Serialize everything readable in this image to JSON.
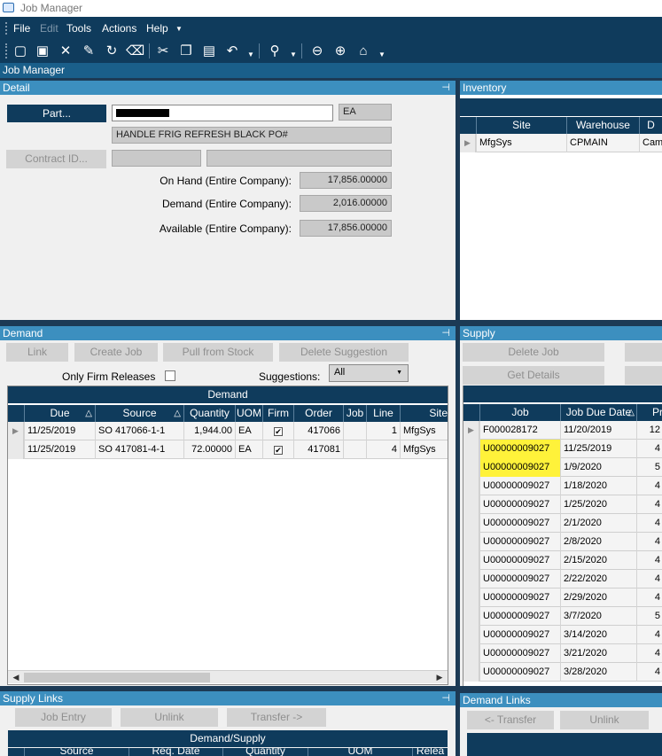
{
  "window": {
    "title": "Job Manager"
  },
  "menu": {
    "file": "File",
    "edit": "Edit",
    "tools": "Tools",
    "actions": "Actions",
    "help": "Help"
  },
  "toolbar_icons": [
    "new-icon",
    "save-icon",
    "delete-icon",
    "edit-icon",
    "refresh-icon",
    "clear-icon",
    "cut-icon",
    "copy-icon",
    "paste-icon",
    "undo-icon",
    "search-icon",
    "back-icon",
    "forward-icon",
    "home-icon"
  ],
  "jobmanager_bar": {
    "title": "Job Manager"
  },
  "detail": {
    "title": "Detail",
    "part_button": "Part...",
    "part_number": "",
    "uom": "EA",
    "description": "HANDLE FRIG REFRESH BLACK PO#",
    "contract_button": "Contract ID...",
    "on_hand_label": "On Hand (Entire Company):",
    "on_hand_value": "17,856.00000",
    "demand_label": "Demand (Entire Company):",
    "demand_value": "2,016.00000",
    "available_label": "Available (Entire Company):",
    "available_value": "17,856.00000"
  },
  "inventory": {
    "title": "Inventory",
    "columns": [
      "Site",
      "Warehouse",
      "D"
    ],
    "rows": [
      {
        "site": "MfgSys",
        "warehouse": "CPMAIN",
        "desc": "Cam"
      }
    ]
  },
  "demand": {
    "title": "Demand",
    "buttons": {
      "link": "Link",
      "create_job": "Create Job",
      "pull_from_stock": "Pull from Stock",
      "delete_suggestion": "Delete Suggestion"
    },
    "only_firm_label": "Only Firm Releases",
    "suggestions_label": "Suggestions:",
    "suggestions_value": "All",
    "grid_title": "Demand",
    "columns": [
      "Due",
      "Source",
      "Quantity",
      "UOM",
      "Firm",
      "Order",
      "Job",
      "Line",
      "Site"
    ],
    "rows": [
      {
        "due": "11/25/2019",
        "source": "SO 417066-1-1",
        "qty": "1,944.00",
        "uom": "EA",
        "order": "417066",
        "job": "",
        "line": "1",
        "site": "MfgSys"
      },
      {
        "due": "11/25/2019",
        "source": "SO 417081-4-1",
        "qty": "72.00000",
        "uom": "EA",
        "order": "417081",
        "job": "",
        "line": "4",
        "site": "MfgSys"
      }
    ]
  },
  "supply": {
    "title": "Supply",
    "buttons": {
      "delete_job": "Delete Job",
      "get_details": "Get Details"
    },
    "columns": [
      "Job",
      "Job Due Date",
      "Pr"
    ],
    "rows": [
      {
        "job": "F000028172",
        "date": "11/20/2019",
        "p": "12"
      },
      {
        "job": "U00000009027",
        "date": "11/25/2019",
        "p": "4"
      },
      {
        "job": "U00000009027",
        "date": "1/9/2020",
        "p": "5"
      },
      {
        "job": "U00000009027",
        "date": "1/18/2020",
        "p": "4"
      },
      {
        "job": "U00000009027",
        "date": "1/25/2020",
        "p": "4"
      },
      {
        "job": "U00000009027",
        "date": "2/1/2020",
        "p": "4"
      },
      {
        "job": "U00000009027",
        "date": "2/8/2020",
        "p": "4"
      },
      {
        "job": "U00000009027",
        "date": "2/15/2020",
        "p": "4"
      },
      {
        "job": "U00000009027",
        "date": "2/22/2020",
        "p": "4"
      },
      {
        "job": "U00000009027",
        "date": "2/29/2020",
        "p": "4"
      },
      {
        "job": "U00000009027",
        "date": "3/7/2020",
        "p": "5"
      },
      {
        "job": "U00000009027",
        "date": "3/14/2020",
        "p": "4"
      },
      {
        "job": "U00000009027",
        "date": "3/21/2020",
        "p": "4"
      },
      {
        "job": "U00000009027",
        "date": "3/28/2020",
        "p": "4"
      }
    ],
    "highlight_color": "#fff23a"
  },
  "supply_links": {
    "title": "Supply Links",
    "buttons": {
      "job_entry": "Job Entry",
      "unlink": "Unlink",
      "transfer": "Transfer ->"
    },
    "grid_title": "Demand/Supply",
    "columns": [
      "Source",
      "Req. Date",
      "Quantity",
      "UOM",
      "Relea"
    ]
  },
  "demand_links": {
    "title": "Demand Links",
    "buttons": {
      "transfer": "<- Transfer",
      "unlink": "Unlink"
    }
  },
  "colors": {
    "accent": "#0f3b5c",
    "panel_header": "#3c8fbf",
    "frame": "#1c3a55"
  }
}
